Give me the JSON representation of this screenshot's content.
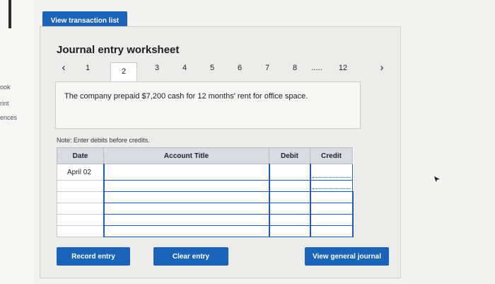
{
  "sidebar": {
    "items": [
      "ook",
      "rint",
      "ences"
    ]
  },
  "toolbar": {
    "view_transaction_list": "View transaction list"
  },
  "worksheet": {
    "title": "Journal entry worksheet",
    "tabs": [
      "1",
      "2",
      "3",
      "4",
      "5",
      "6",
      "7",
      "8",
      ".....",
      "12"
    ],
    "active_tab": "2",
    "prev_icon": "chevron-left",
    "next_icon": "chevron-right",
    "description": "The company prepaid $7,200 cash for 12 months' rent for office space.",
    "note": "Note: Enter debits before credits."
  },
  "table": {
    "headers": [
      "Date",
      "Account Title",
      "Debit",
      "Credit"
    ],
    "rows": [
      [
        "April 02",
        "",
        "",
        ""
      ],
      [
        "",
        "",
        "",
        ""
      ],
      [
        "",
        "",
        "",
        ""
      ],
      [
        "",
        "",
        "",
        ""
      ],
      [
        "",
        "",
        "",
        ""
      ],
      [
        "",
        "",
        "",
        ""
      ]
    ]
  },
  "buttons": {
    "record": "Record entry",
    "clear": "Clear entry",
    "general_journal": "View general journal"
  },
  "colors": {
    "accent": "#1a63b8",
    "header_bg": "#d8dbe1"
  }
}
